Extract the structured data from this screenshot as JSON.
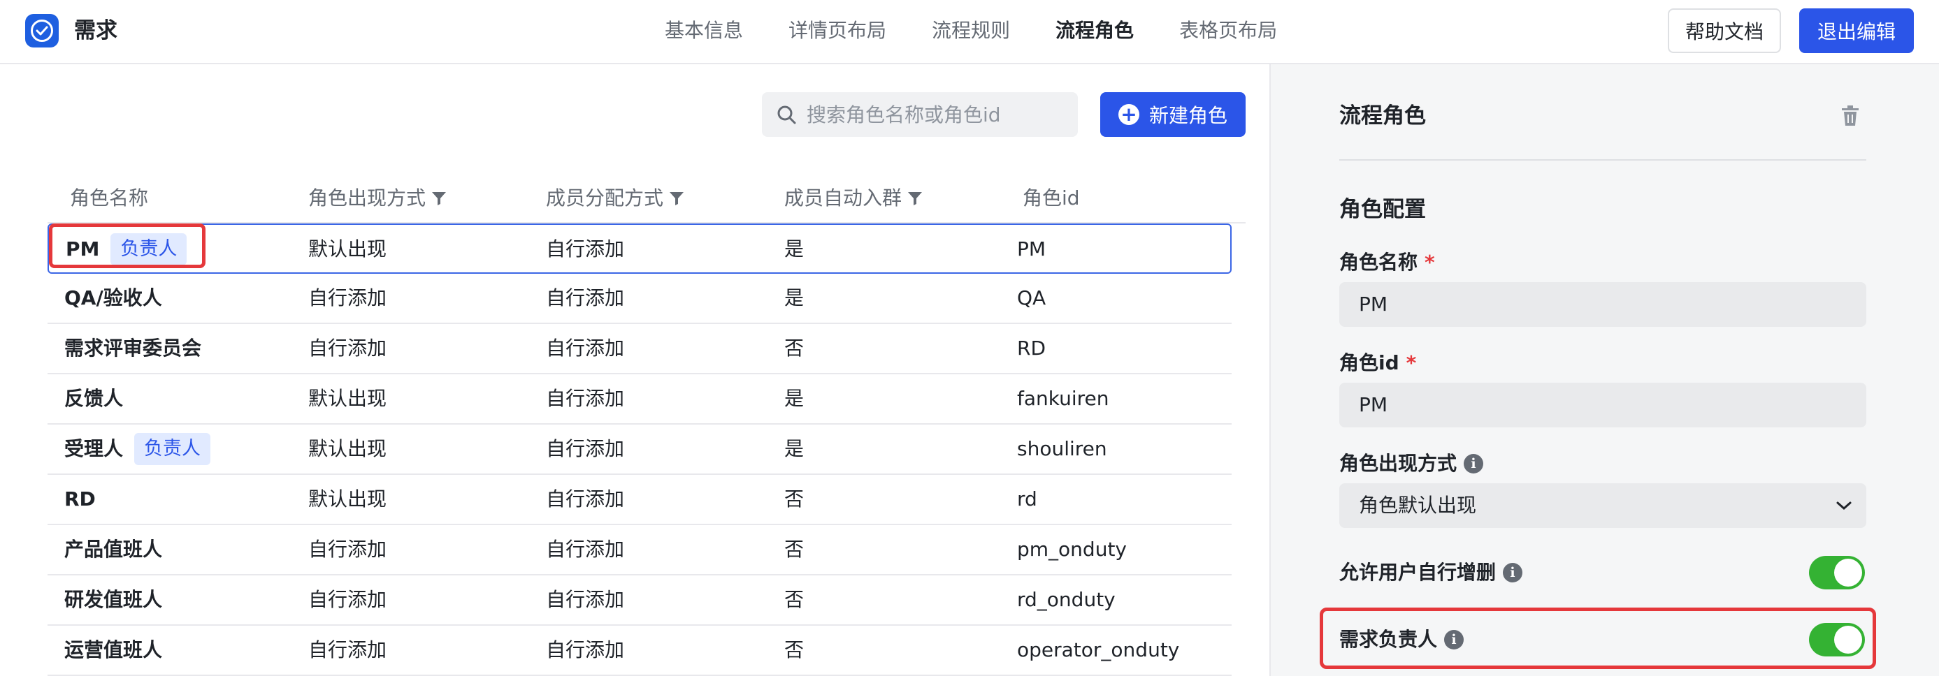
{
  "header": {
    "app_title": "需求",
    "tabs": [
      {
        "label": "基本信息",
        "active": false
      },
      {
        "label": "详情页布局",
        "active": false
      },
      {
        "label": "流程规则",
        "active": false
      },
      {
        "label": "流程角色",
        "active": true
      },
      {
        "label": "表格页布局",
        "active": false
      }
    ],
    "help_label": "帮助文档",
    "exit_label": "退出编辑"
  },
  "toolbar": {
    "search_placeholder": "搜索角色名称或角色id",
    "new_role_label": "新建角色"
  },
  "table": {
    "columns": [
      "角色名称",
      "角色出现方式",
      "成员分配方式",
      "成员自动入群",
      "角色id"
    ],
    "rows": [
      {
        "name": "PM",
        "tag": "负责人",
        "appearance": "默认出现",
        "assign": "自行添加",
        "auto_join": "是",
        "id": "PM"
      },
      {
        "name": "QA/验收人",
        "tag": "",
        "appearance": "自行添加",
        "assign": "自行添加",
        "auto_join": "是",
        "id": "QA"
      },
      {
        "name": "需求评审委员会",
        "tag": "",
        "appearance": "自行添加",
        "assign": "自行添加",
        "auto_join": "否",
        "id": "RD"
      },
      {
        "name": "反馈人",
        "tag": "",
        "appearance": "默认出现",
        "assign": "自行添加",
        "auto_join": "是",
        "id": "fankuiren"
      },
      {
        "name": "受理人",
        "tag": "负责人",
        "appearance": "默认出现",
        "assign": "自行添加",
        "auto_join": "是",
        "id": "shouliren"
      },
      {
        "name": "RD",
        "tag": "",
        "appearance": "默认出现",
        "assign": "自行添加",
        "auto_join": "否",
        "id": "rd"
      },
      {
        "name": "产品值班人",
        "tag": "",
        "appearance": "自行添加",
        "assign": "自行添加",
        "auto_join": "否",
        "id": "pm_onduty"
      },
      {
        "name": "研发值班人",
        "tag": "",
        "appearance": "自行添加",
        "assign": "自行添加",
        "auto_join": "否",
        "id": "rd_onduty"
      },
      {
        "name": "运营值班人",
        "tag": "",
        "appearance": "自行添加",
        "assign": "自行添加",
        "auto_join": "否",
        "id": "operator_onduty"
      }
    ]
  },
  "panel": {
    "title": "流程角色",
    "section_title": "角色配置",
    "role_name_label": "角色名称",
    "role_name_value": "PM",
    "role_id_label": "角色id",
    "role_id_value": "PM",
    "appearance_label": "角色出现方式",
    "appearance_value": "角色默认出现",
    "allow_edit_label": "允许用户自行增删",
    "owner_label": "需求负责人",
    "required_mark": "*"
  }
}
